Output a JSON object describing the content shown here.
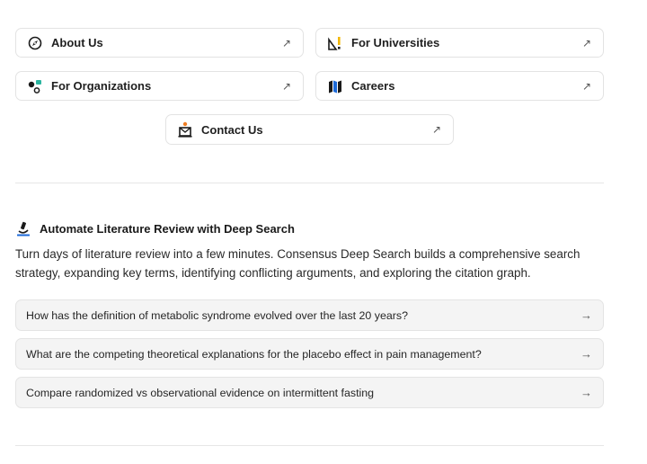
{
  "links": [
    {
      "label": "About Us",
      "icon": "compass-icon"
    },
    {
      "label": "For Universities",
      "icon": "graduation-icon"
    },
    {
      "label": "For Organizations",
      "icon": "organization-icon"
    },
    {
      "label": "Careers",
      "icon": "map-icon"
    },
    {
      "label": "Contact Us",
      "icon": "contact-icon"
    }
  ],
  "link_arrow": "↗",
  "deep_search": {
    "title": "Automate Literature Review with Deep Search",
    "icon": "microscope-icon",
    "description": "Turn days of literature review into a few minutes. Consensus Deep Search builds a comprehensive search strategy, expanding key terms, identifying conflicting arguments, and exploring the citation graph.",
    "queries": [
      "How has the definition of metabolic syndrome evolved over the last 20 years?",
      "What are the competing theoretical explanations for the placebo effect in pain management?",
      "Compare randomized vs observational evidence on intermittent fasting"
    ],
    "query_arrow": "→"
  },
  "colors": {
    "accent_blue": "#1d6ad8",
    "accent_yellow": "#f2b705",
    "accent_orange": "#ef7d22",
    "accent_teal": "#2bb5a0"
  }
}
